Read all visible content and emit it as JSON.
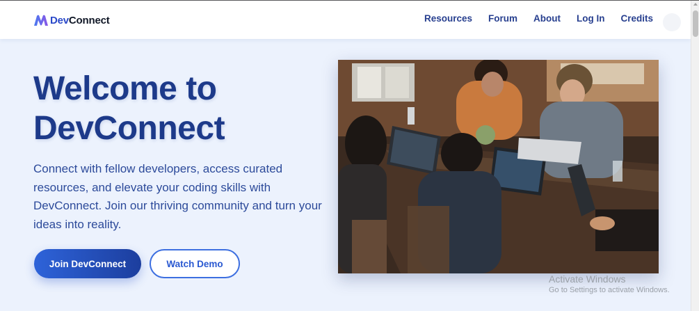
{
  "brand": {
    "prefix": "Dev",
    "suffix": "Connect"
  },
  "nav": {
    "links": [
      "Resources",
      "Forum",
      "About",
      "Log In",
      "Credits"
    ]
  },
  "hero": {
    "title_line1": "Welcome to",
    "title_line2": "DevConnect",
    "description": "Connect with fellow developers, access curated resources, and elevate your coding skills with DevConnect. Join our thriving community and turn your ideas into reality.",
    "primary_button": "Join DevConnect",
    "secondary_button": "Watch Demo"
  },
  "os_watermark": {
    "line1": "Activate Windows",
    "line2": "Go to Settings to activate Windows."
  },
  "colors": {
    "accent": "#2e63d9",
    "heading": "#1d3a8a",
    "background": "#ecf2fd"
  }
}
